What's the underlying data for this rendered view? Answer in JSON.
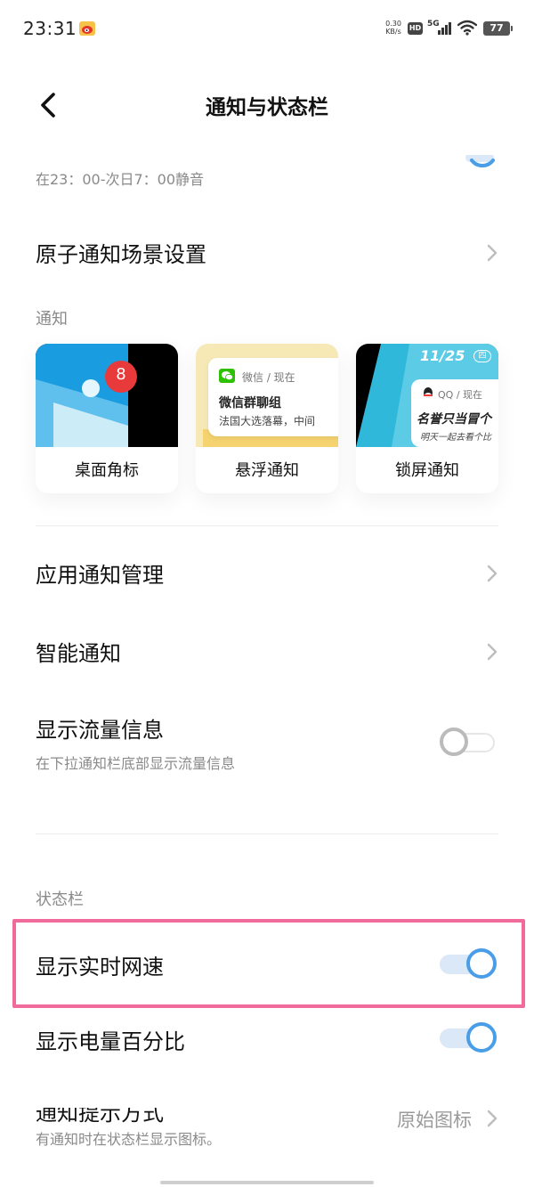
{
  "status_bar": {
    "time": "23:31",
    "speed_value": "0.30",
    "speed_unit": "KB/s",
    "hd": "HD",
    "network": "5G",
    "battery": "77",
    "weibo_icon": "weibo-icon",
    "wifi_icon": "wifi-icon",
    "signal_icon": "signal-icon"
  },
  "header": {
    "title": "通知与状态栏",
    "back_icon": "chevron-left-icon"
  },
  "dnd": {
    "subtitle": "在23：00-次日7：00静音",
    "toggle_on": true
  },
  "atomic_scene": {
    "title": "原子通知场景设置"
  },
  "notification_section": {
    "label": "通知",
    "cards": [
      {
        "label": "桌面角标",
        "badge": "8"
      },
      {
        "label": "悬浮通知",
        "app": "微信 / 现在",
        "title": "微信群聊组",
        "body": "法国大选落幕，中间"
      },
      {
        "label": "锁屏通知",
        "date": "11/25",
        "weekday": "四",
        "app": "QQ / 现在",
        "title": "名誉只当冒个",
        "body": "明天一起去看个比"
      }
    ]
  },
  "app_notification_manage": {
    "title": "应用通知管理"
  },
  "smart_notification": {
    "title": "智能通知"
  },
  "show_traffic": {
    "title": "显示流量信息",
    "subtitle": "在下拉通知栏底部显示流量信息",
    "toggle_on": false
  },
  "status_bar_section": {
    "label": "状态栏",
    "realtime_speed": {
      "title": "显示实时网速",
      "toggle_on": true
    },
    "battery_percent": {
      "title": "显示电量百分比",
      "toggle_on": true
    },
    "notify_style": {
      "title": "通知提示方式",
      "subtitle": "有通知时在状态栏显示图标。",
      "value": "原始图标"
    }
  },
  "colors": {
    "accent": "#4a9ee8",
    "highlight": "#f06a9a"
  }
}
